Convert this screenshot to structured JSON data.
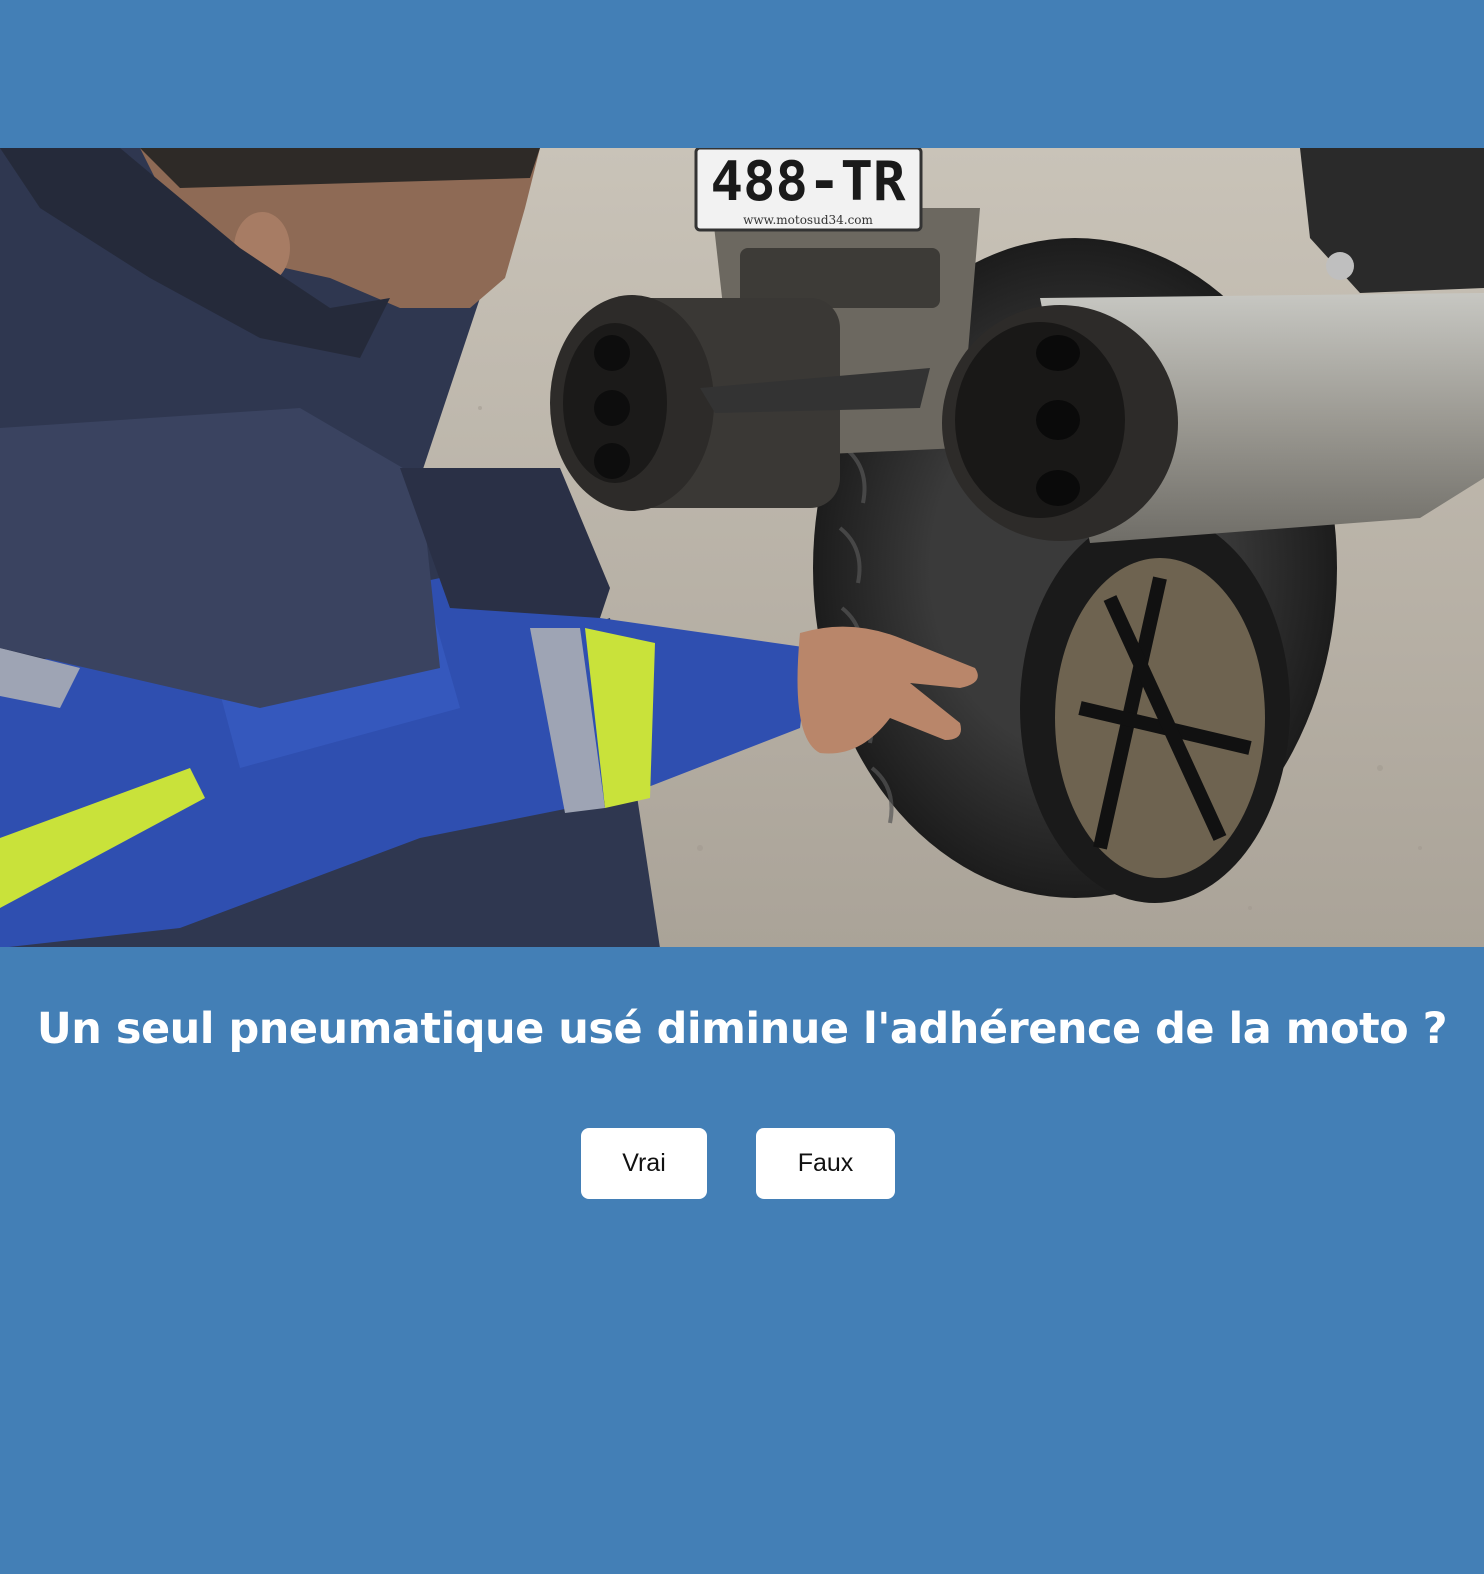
{
  "colors": {
    "background": "#437fb6",
    "button_bg": "#ffffff",
    "question_text": "#ffffff"
  },
  "photo": {
    "plate_text": "488-TR",
    "plate_site": "www.motosud34.com"
  },
  "question": {
    "text": "Un seul pneumatique usé diminue l'adhérence de la moto ?"
  },
  "answers": [
    {
      "label": "Vrai"
    },
    {
      "label": "Faux"
    }
  ]
}
